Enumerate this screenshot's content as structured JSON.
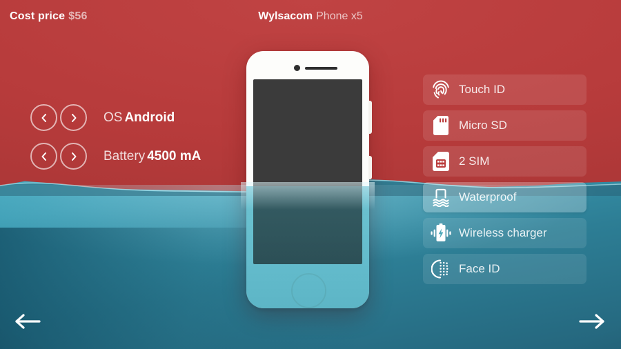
{
  "header": {
    "cost_label": "Cost price",
    "cost_value": "$56",
    "brand": "Wylsacom",
    "model": "Phone x5"
  },
  "specs": [
    {
      "name": "os",
      "label": "OS",
      "value": "Android",
      "prev_icon": "chevron-left-icon",
      "next_icon": "chevron-right-icon"
    },
    {
      "name": "battery",
      "label": "Battery",
      "value": "4500 mA",
      "prev_icon": "chevron-left-icon",
      "next_icon": "chevron-right-icon"
    }
  ],
  "features": [
    {
      "label": "Touch ID",
      "icon": "fingerprint-icon",
      "active": false
    },
    {
      "label": "Micro SD",
      "icon": "sd-card-icon",
      "active": false
    },
    {
      "label": "2 SIM",
      "icon": "sim-card-icon",
      "active": false
    },
    {
      "label": "Waterproof",
      "icon": "waterproof-icon",
      "active": true
    },
    {
      "label": "Wireless charger",
      "icon": "wireless-charger-icon",
      "active": false
    },
    {
      "label": "Face ID",
      "icon": "face-id-icon",
      "active": false
    }
  ],
  "nav": {
    "prev_icon": "arrow-left-icon",
    "next_icon": "arrow-right-icon"
  },
  "colors": {
    "air_red": "#b93c3c",
    "water_light": "#4ab6c9",
    "water_deep": "#24657c",
    "phone_body": "#fdfdfb",
    "phone_screen": "#3b3b3b",
    "text_white": "#ffffff"
  }
}
